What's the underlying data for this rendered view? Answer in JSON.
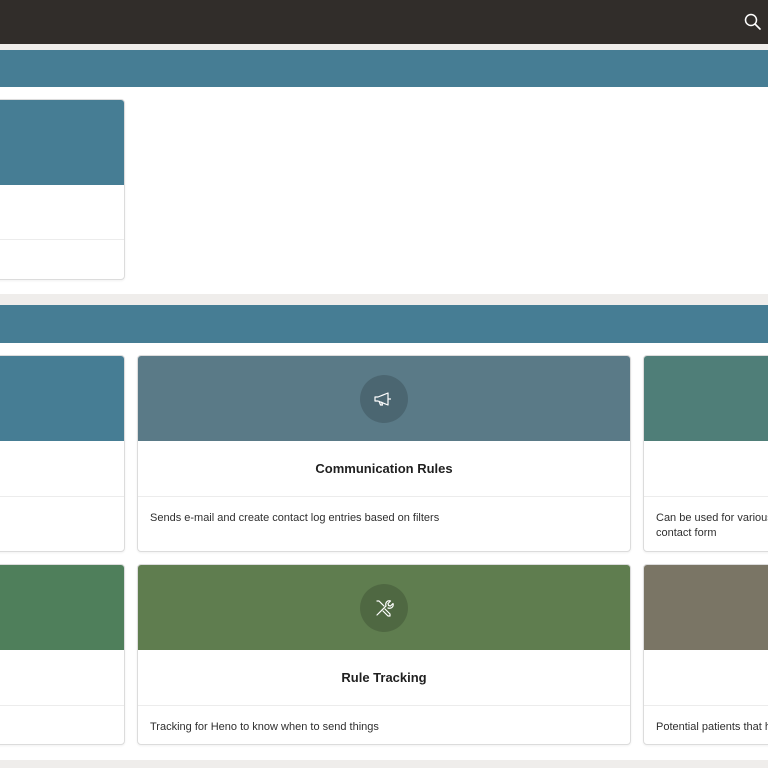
{
  "colors": {
    "top_bar": "#312d2a",
    "region_header": "#467d94",
    "page_background": "#efedeb"
  },
  "cards": [
    {
      "title": "",
      "description": "",
      "banner_color": "#467d94",
      "icon": ""
    },
    {
      "title": "",
      "description": "",
      "banner_color": "#467d94",
      "icon": ""
    },
    {
      "title": "Communication Rules",
      "description": "Sends e-mail and create contact log entries based on filters",
      "banner_color": "#5a7a87",
      "icon": "megaphone-icon"
    },
    {
      "title": "",
      "description": "Can be used for various contact form",
      "banner_color": "#4f7e78",
      "icon": ""
    },
    {
      "title": "",
      "description": "",
      "banner_color": "#4f7f5b",
      "icon": ""
    },
    {
      "title": "Rule Tracking",
      "description": "Tracking for Heno to know when to send things",
      "banner_color": "#5f7d4f",
      "icon": "tools-icon"
    },
    {
      "title": "",
      "description": "Potential patients that h",
      "banner_color": "#7a7565",
      "icon": ""
    }
  ]
}
